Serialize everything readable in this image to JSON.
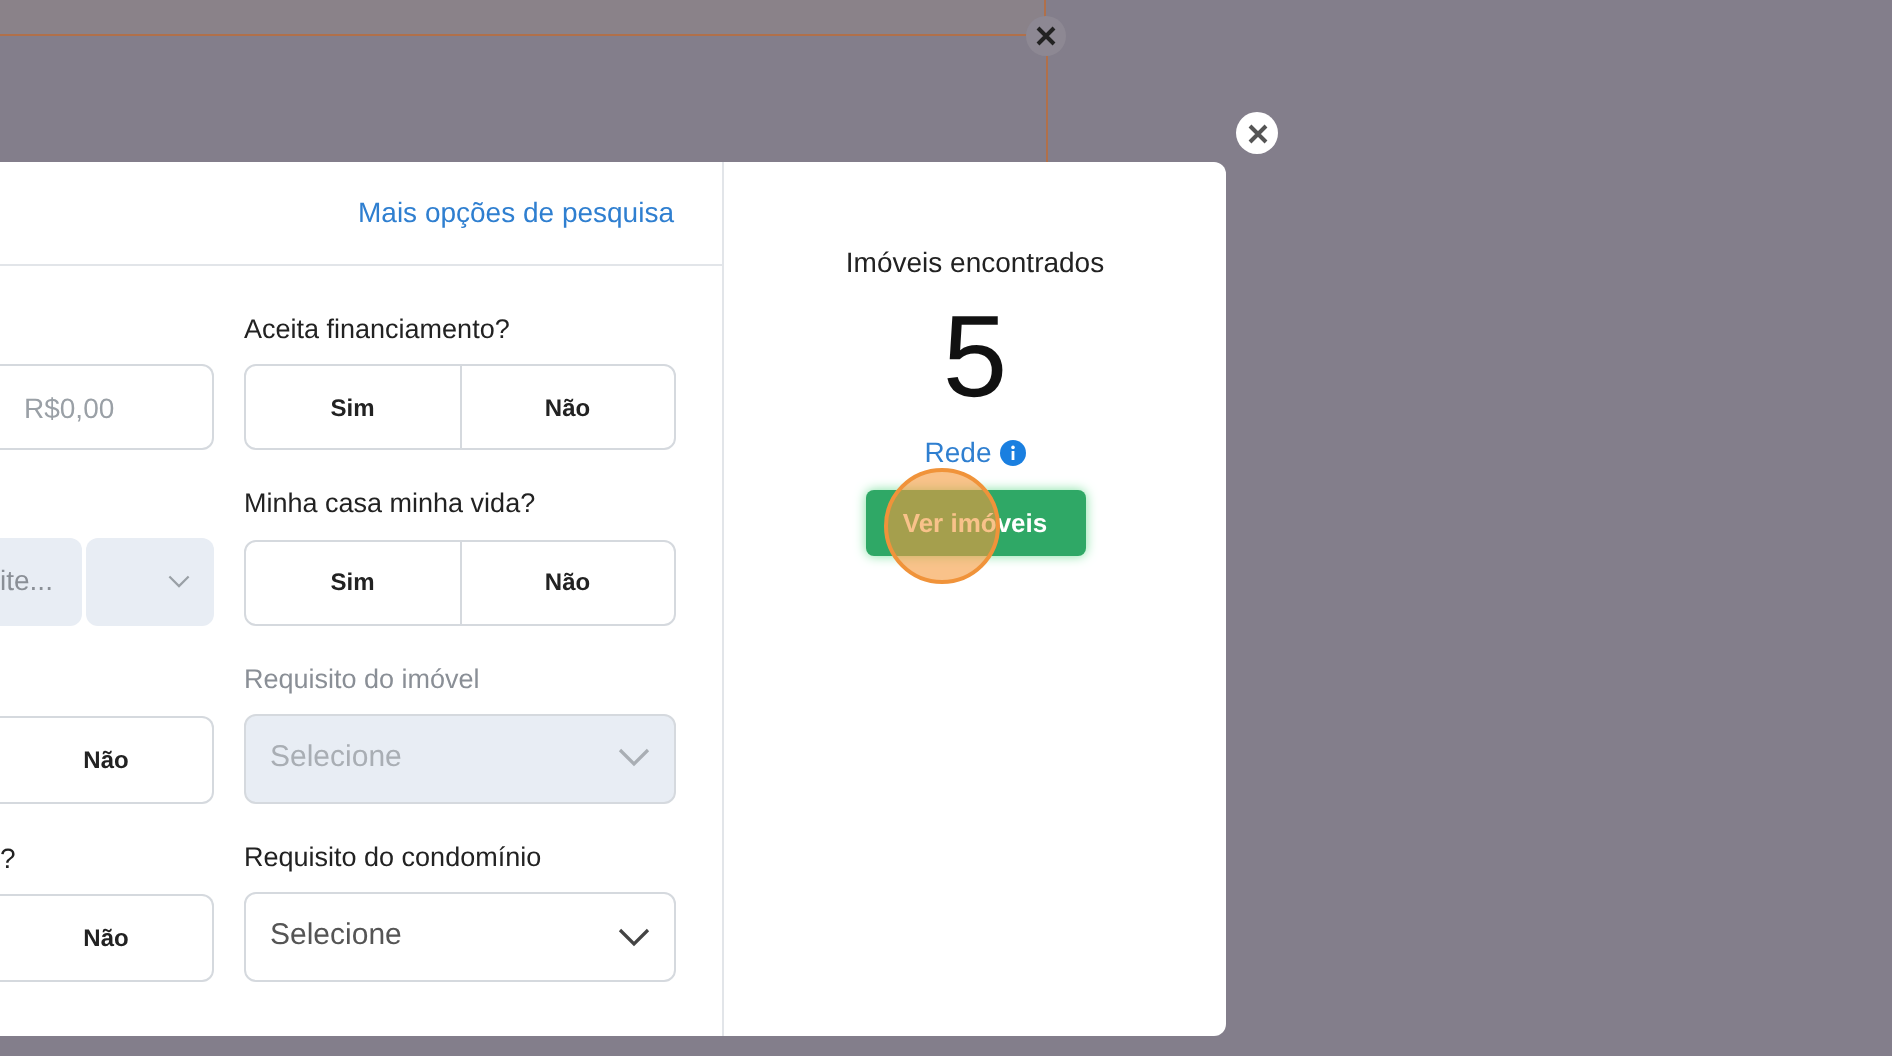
{
  "link": "Mais opções de pesquisa",
  "left_column": [
    {
      "kind": "input",
      "placeholder": "R$0,00"
    },
    {
      "kind": "range",
      "value": "ite..."
    },
    {
      "kind": "toggle",
      "option": "Não",
      "selected": false
    },
    {
      "kind": "toggle",
      "label": "?",
      "option": "Não",
      "selected": false
    }
  ],
  "right_column": [
    {
      "kind": "toggle",
      "label": "Aceita financiamento?",
      "disabled": false,
      "options": [
        {
          "label": "Sim",
          "selected": false
        },
        {
          "label": "Não",
          "selected": false
        }
      ]
    },
    {
      "kind": "toggle",
      "label": "Minha casa minha vida?",
      "disabled": false,
      "options": [
        {
          "label": "Sim",
          "selected": false
        },
        {
          "label": "Não",
          "selected": false
        }
      ]
    },
    {
      "kind": "select",
      "label": "Requisito do imóvel",
      "disabled": true,
      "placeholder": "Selecione"
    },
    {
      "kind": "select",
      "label": "Requisito do condomínio",
      "disabled": false,
      "placeholder": "Selecione"
    }
  ],
  "results": {
    "title": "Imóveis encontrados",
    "count": "5",
    "source": "Rede",
    "button": "Ver imóveis"
  }
}
